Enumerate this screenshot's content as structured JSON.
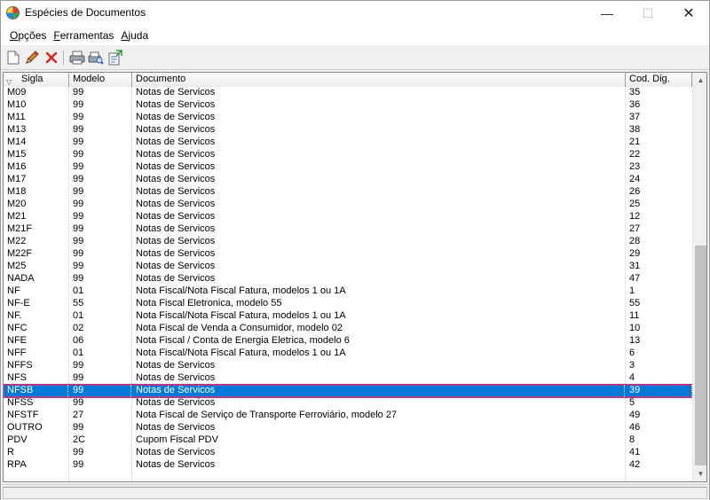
{
  "window": {
    "title": "Espécies de Documentos",
    "minimize_glyph": "—",
    "maximize_glyph": "☐",
    "close_glyph": "✕"
  },
  "menu": [
    {
      "pre": "",
      "acc": "O",
      "post": "pções"
    },
    {
      "pre": "",
      "acc": "F",
      "post": "erramentas"
    },
    {
      "pre": "",
      "acc": "A",
      "post": "juda"
    }
  ],
  "toolbar": {
    "icons": [
      "new-document-icon",
      "edit-pencil-icon",
      "delete-x-icon",
      "print-icon",
      "print-preview-icon",
      "export-icon"
    ]
  },
  "columns": [
    "Sigla",
    "Modelo",
    "Documento",
    "Cod. Dig."
  ],
  "sort_glyph": "▽",
  "rows": [
    [
      "M09",
      "99",
      "Notas de Servicos",
      "35"
    ],
    [
      "M10",
      "99",
      "Notas de Servicos",
      "36"
    ],
    [
      "M11",
      "99",
      "Notas de Servicos",
      "37"
    ],
    [
      "M13",
      "99",
      "Notas de Servicos",
      "38"
    ],
    [
      "M14",
      "99",
      "Notas de Servicos",
      "21"
    ],
    [
      "M15",
      "99",
      "Notas de Servicos",
      "22"
    ],
    [
      "M16",
      "99",
      "Notas de Servicos",
      "23"
    ],
    [
      "M17",
      "99",
      "Notas de Servicos",
      "24"
    ],
    [
      "M18",
      "99",
      "Notas de Servicos",
      "26"
    ],
    [
      "M20",
      "99",
      "Notas de Servicos",
      "25"
    ],
    [
      "M21",
      "99",
      "Notas de Servicos",
      "12"
    ],
    [
      "M21F",
      "99",
      "Notas de Servicos",
      "27"
    ],
    [
      "M22",
      "99",
      "Notas de Servicos",
      "28"
    ],
    [
      "M22F",
      "99",
      "Notas de Servicos",
      "29"
    ],
    [
      "M25",
      "99",
      "Notas de Servicos",
      "31"
    ],
    [
      "NADA",
      "99",
      "Notas de Servicos",
      "47"
    ],
    [
      "NF",
      "01",
      "Nota Fiscal/Nota Fiscal Fatura, modelos 1 ou 1A",
      "1"
    ],
    [
      "NF-E",
      "55",
      "Nota Fiscal Eletronica, modelo 55",
      "55"
    ],
    [
      "NF.",
      "01",
      "Nota Fiscal/Nota Fiscal Fatura, modelos 1 ou 1A",
      "11"
    ],
    [
      "NFC",
      "02",
      "Nota Fiscal de Venda a Consumidor, modelo 02",
      "10"
    ],
    [
      "NFE",
      "06",
      "Nota Fiscal / Conta de Energia Eletrica, modelo 6",
      "13"
    ],
    [
      "NFF",
      "01",
      "Nota Fiscal/Nota Fiscal Fatura, modelos 1 ou 1A",
      "6"
    ],
    [
      "NFFS",
      "99",
      "Notas de Servicos",
      "3"
    ],
    [
      "NFS",
      "99",
      "Notas de Servicos",
      "4"
    ],
    [
      "NFSB",
      "99",
      "Notas de Servicos",
      "39"
    ],
    [
      "NFSS",
      "99",
      "Notas de Servicos",
      "5"
    ],
    [
      "NFSTF",
      "27",
      "Nota Fiscal de Serviço de Transporte Ferroviário, modelo 27",
      "49"
    ],
    [
      "OUTRO",
      "99",
      "Notas de Servicos",
      "46"
    ],
    [
      "PDV",
      "2C",
      "Cupom Fiscal PDV",
      "8"
    ],
    [
      "R",
      "99",
      "Notas de Servicos",
      "41"
    ],
    [
      "RPA",
      "99",
      "Notas de Servicos",
      "42"
    ]
  ],
  "selected_row": 24,
  "colors": {
    "selection": "#0078d7",
    "selection_outline": "#b03a8a"
  }
}
